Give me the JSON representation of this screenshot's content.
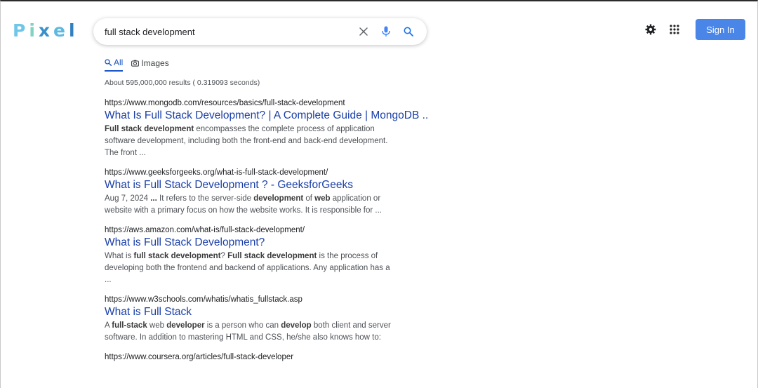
{
  "logo": {
    "letters": [
      {
        "ch": "P",
        "color": "#6ec6e8"
      },
      {
        "ch": "i",
        "color": "#7fd3c3"
      },
      {
        "ch": "x",
        "color": "#3a90c8"
      },
      {
        "ch": "e",
        "color": "#5fb8e0"
      },
      {
        "ch": "l",
        "color": "#2f7fc1"
      }
    ]
  },
  "search": {
    "value": "full stack development",
    "placeholder": ""
  },
  "header": {
    "signin_label": "Sign In"
  },
  "tabs": [
    {
      "label": "All",
      "icon": "search-icon",
      "active": true
    },
    {
      "label": "Images",
      "icon": "camera-icon",
      "active": false
    }
  ],
  "stats": "About 595,000,000 results ( 0.319093 seconds)",
  "results": [
    {
      "url": "https://www.mongodb.com/resources/basics/full-stack-development",
      "title": "What Is Full Stack Development? | A Complete Guide | MongoDB ...",
      "snippet": [
        {
          "t": "Full stack development",
          "b": true
        },
        {
          "t": " encompasses the complete process of application software development, including both the front-end and back-end development. The front ...",
          "b": false
        }
      ]
    },
    {
      "url": "https://www.geeksforgeeks.org/what-is-full-stack-development/",
      "title": "What is Full Stack Development ? - GeeksforGeeks",
      "snippet": [
        {
          "t": "Aug 7, 2024 ",
          "b": false
        },
        {
          "t": "...",
          "b": true
        },
        {
          "t": " It refers to the server-side ",
          "b": false
        },
        {
          "t": "development",
          "b": true
        },
        {
          "t": " of ",
          "b": false
        },
        {
          "t": "web",
          "b": true
        },
        {
          "t": " application or website with a primary focus on how the website works. It is responsible for ...",
          "b": false
        }
      ]
    },
    {
      "url": "https://aws.amazon.com/what-is/full-stack-development/",
      "title": "What is Full Stack Development?",
      "snippet": [
        {
          "t": "What is ",
          "b": false
        },
        {
          "t": "full stack development",
          "b": true
        },
        {
          "t": "? ",
          "b": false
        },
        {
          "t": "Full stack development",
          "b": true
        },
        {
          "t": " is the process of developing both the frontend and backend of applications. Any application has a ...",
          "b": false
        }
      ]
    },
    {
      "url": "https://www.w3schools.com/whatis/whatis_fullstack.asp",
      "title": "What is Full Stack",
      "snippet": [
        {
          "t": "A ",
          "b": false
        },
        {
          "t": "full-stack",
          "b": true
        },
        {
          "t": " web ",
          "b": false
        },
        {
          "t": "developer",
          "b": true
        },
        {
          "t": " is a person who can ",
          "b": false
        },
        {
          "t": "develop",
          "b": true
        },
        {
          "t": " both client and server software. In addition to mastering HTML and CSS, he/she also knows how to:",
          "b": false
        }
      ]
    },
    {
      "url": "https://www.coursera.org/articles/full-stack-developer",
      "title": "",
      "snippet": []
    }
  ]
}
